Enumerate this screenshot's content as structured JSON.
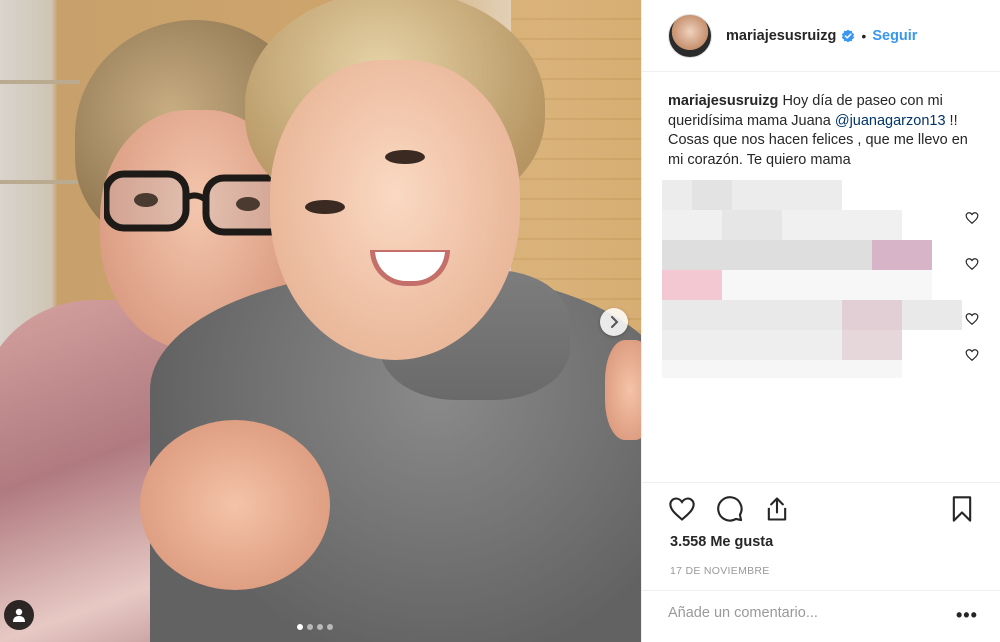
{
  "header": {
    "username": "mariajesusruizg",
    "separator": "•",
    "follow_label": "Seguir",
    "avatar_icon": "profile-avatar",
    "verified_icon": "verified-badge-icon"
  },
  "caption": {
    "username": "mariajesusruizg",
    "text_before": "Hoy día de paseo con mi queridísima mama Juana",
    "mention": "@juanagarzon13",
    "text_after": "!! Cosas que nos hacen felices , que me llevo en mi corazón. Te quiero mama"
  },
  "actions": {
    "like_icon": "heart-icon",
    "comment_icon": "comment-icon",
    "share_icon": "share-icon",
    "save_icon": "bookmark-icon"
  },
  "likes_text": "3.558 Me gusta",
  "date_text": "17 DE NOVIEMBRE",
  "comment_placeholder": "Añade un comentario...",
  "more_label": "•••",
  "carousel": {
    "total_slides": 4,
    "active_slide": 1
  },
  "colors": {
    "link_blue": "#3897f0",
    "mention_blue": "#003569",
    "text": "#262626",
    "muted": "#999999",
    "divider": "#efefef"
  }
}
